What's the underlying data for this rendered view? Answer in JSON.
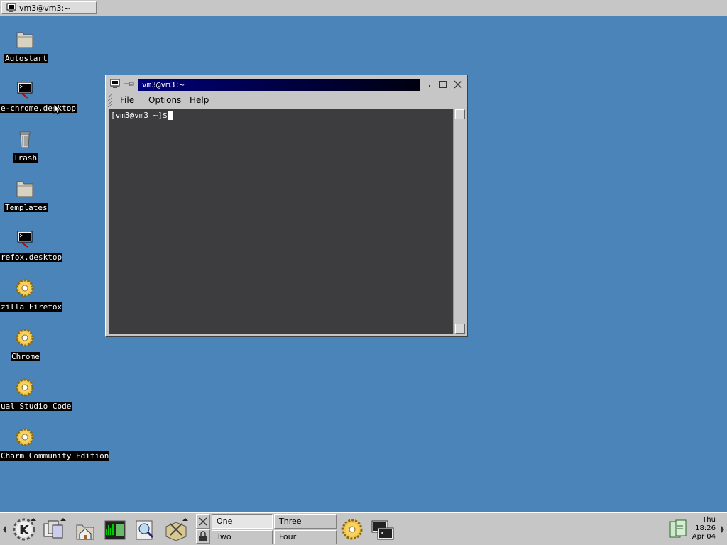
{
  "top_taskbar": {
    "task_label": "vm3@vm3:~"
  },
  "desktop_icons": [
    {
      "label": "Autostart",
      "icon": "folder-icon"
    },
    {
      "label": "e-chrome.desktop",
      "icon": "terminal-launcher-icon"
    },
    {
      "label": "Trash",
      "icon": "trash-icon"
    },
    {
      "label": "Templates",
      "icon": "folder-icon"
    },
    {
      "label": "refox.desktop",
      "icon": "terminal-launcher-icon"
    },
    {
      "label": "zilla Firefox",
      "icon": "gear-icon"
    },
    {
      "label": "Chrome",
      "icon": "gear-icon"
    },
    {
      "label": "ual Studio Code",
      "icon": "gear-icon"
    },
    {
      "label": "Charm Community Edition",
      "icon": "gear-icon"
    }
  ],
  "terminal": {
    "title": "vm3@vm3:~",
    "menu": {
      "file": "File",
      "options": "Options",
      "help": "Help"
    },
    "prompt": "[vm3@vm3 ~]$"
  },
  "panel": {
    "desktops": {
      "one": "One",
      "two": "Two",
      "three": "Three",
      "four": "Four"
    },
    "active_desktop": "One",
    "clock": {
      "day": "Thu",
      "time": "18:26",
      "date": "Apr 04"
    }
  },
  "colors": {
    "desktop_background": "#4a84b8",
    "terminal_background": "#3d3d3f",
    "titlebar_active": "#00007a",
    "panel": "#c6c6c6"
  }
}
